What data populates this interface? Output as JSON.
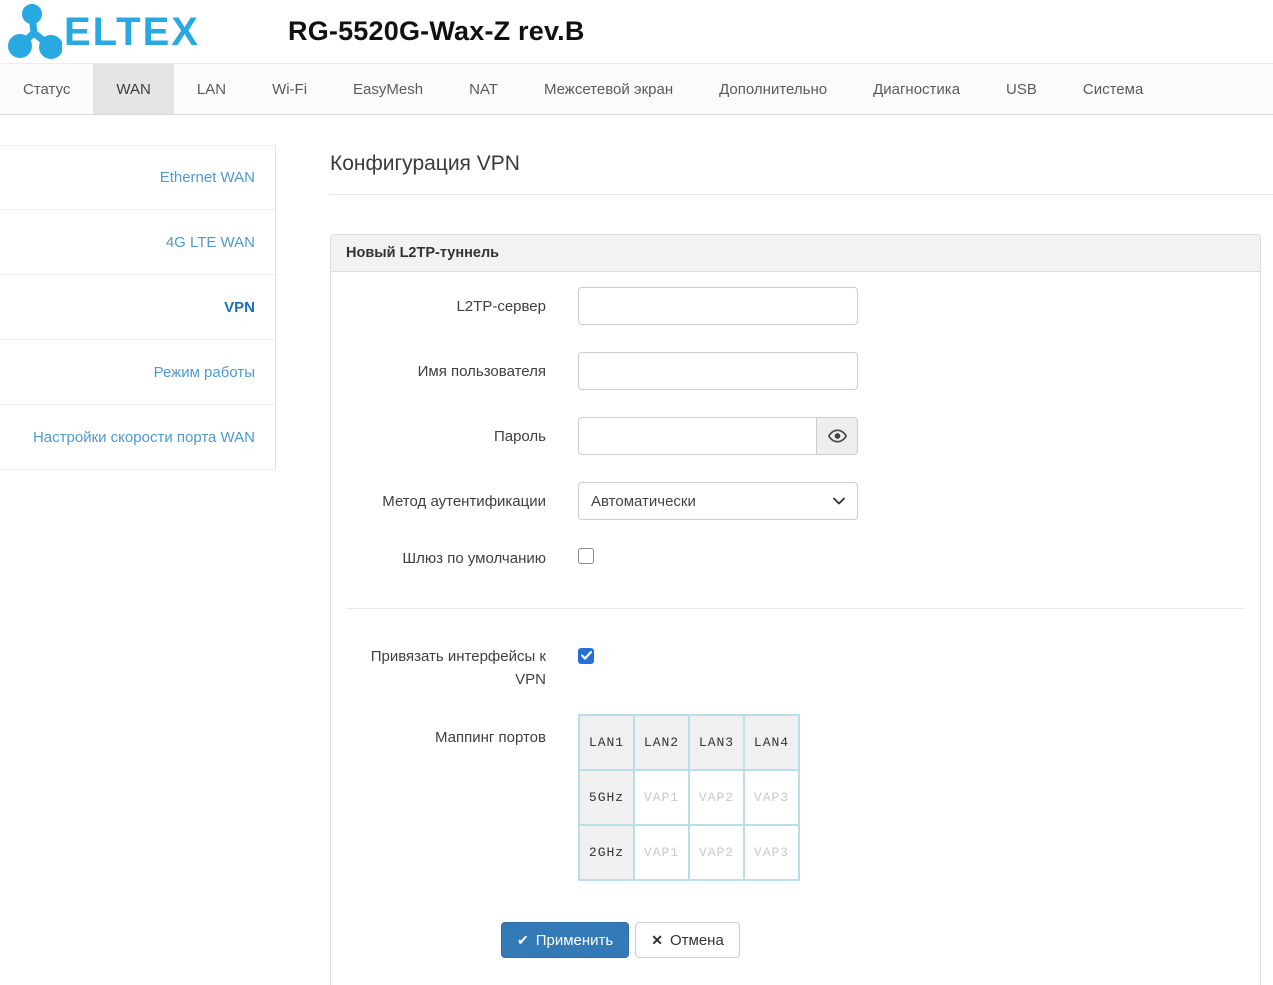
{
  "header": {
    "logo_text": "ELTEX",
    "device_title": "RG-5520G-Wax-Z rev.B"
  },
  "nav": {
    "active": "WAN",
    "tabs": [
      "Статус",
      "WAN",
      "LAN",
      "Wi-Fi",
      "EasyMesh",
      "NAT",
      "Межсетевой экран",
      "Дополнительно",
      "Диагностика",
      "USB",
      "Система"
    ]
  },
  "sidebar": {
    "active": "VPN",
    "items": [
      "Ethernet WAN",
      "4G LTE WAN",
      "VPN",
      "Режим работы",
      "Настройки скорости порта WAN"
    ]
  },
  "main": {
    "page_title": "Конфигурация VPN",
    "panel_title": "Новый L2TP-туннель",
    "fields": {
      "l2tp_server": {
        "label": "L2TP-сервер",
        "value": ""
      },
      "username": {
        "label": "Имя пользователя",
        "value": ""
      },
      "password": {
        "label": "Пароль",
        "value": ""
      },
      "auth_method": {
        "label": "Метод аутентификации",
        "value": "Автоматически"
      },
      "default_gateway": {
        "label": "Шлюз по умолчанию",
        "checked": false
      },
      "bind_interfaces": {
        "label": "Привязать интерфейсы к VPN",
        "checked": true
      },
      "port_mapping": {
        "label": "Маппинг портов"
      }
    },
    "port_table": {
      "rows": [
        [
          "LAN1",
          "LAN2",
          "LAN3",
          "LAN4"
        ],
        [
          "5GHz",
          "VAP1",
          "VAP2",
          "VAP3"
        ],
        [
          "2GHz",
          "VAP1",
          "VAP2",
          "VAP3"
        ]
      ]
    },
    "buttons": {
      "apply": "Применить",
      "apply_icon": "✔",
      "cancel": "Отмена",
      "cancel_icon": "✕"
    }
  },
  "icons": {
    "eye": "eye-icon",
    "chevron": "chevron-down-icon",
    "check_glyph": "✔",
    "x_glyph": "✕"
  },
  "colors": {
    "logo_blue": "#29a9e1",
    "link_blue": "#4d9ad5",
    "active_link_blue": "#1b6ec2",
    "primary_button": "#337ab7",
    "checkbox_checked": "#2370d8",
    "table_border": "#b9dfec",
    "tab_active_bg": "#e4e4e4"
  }
}
